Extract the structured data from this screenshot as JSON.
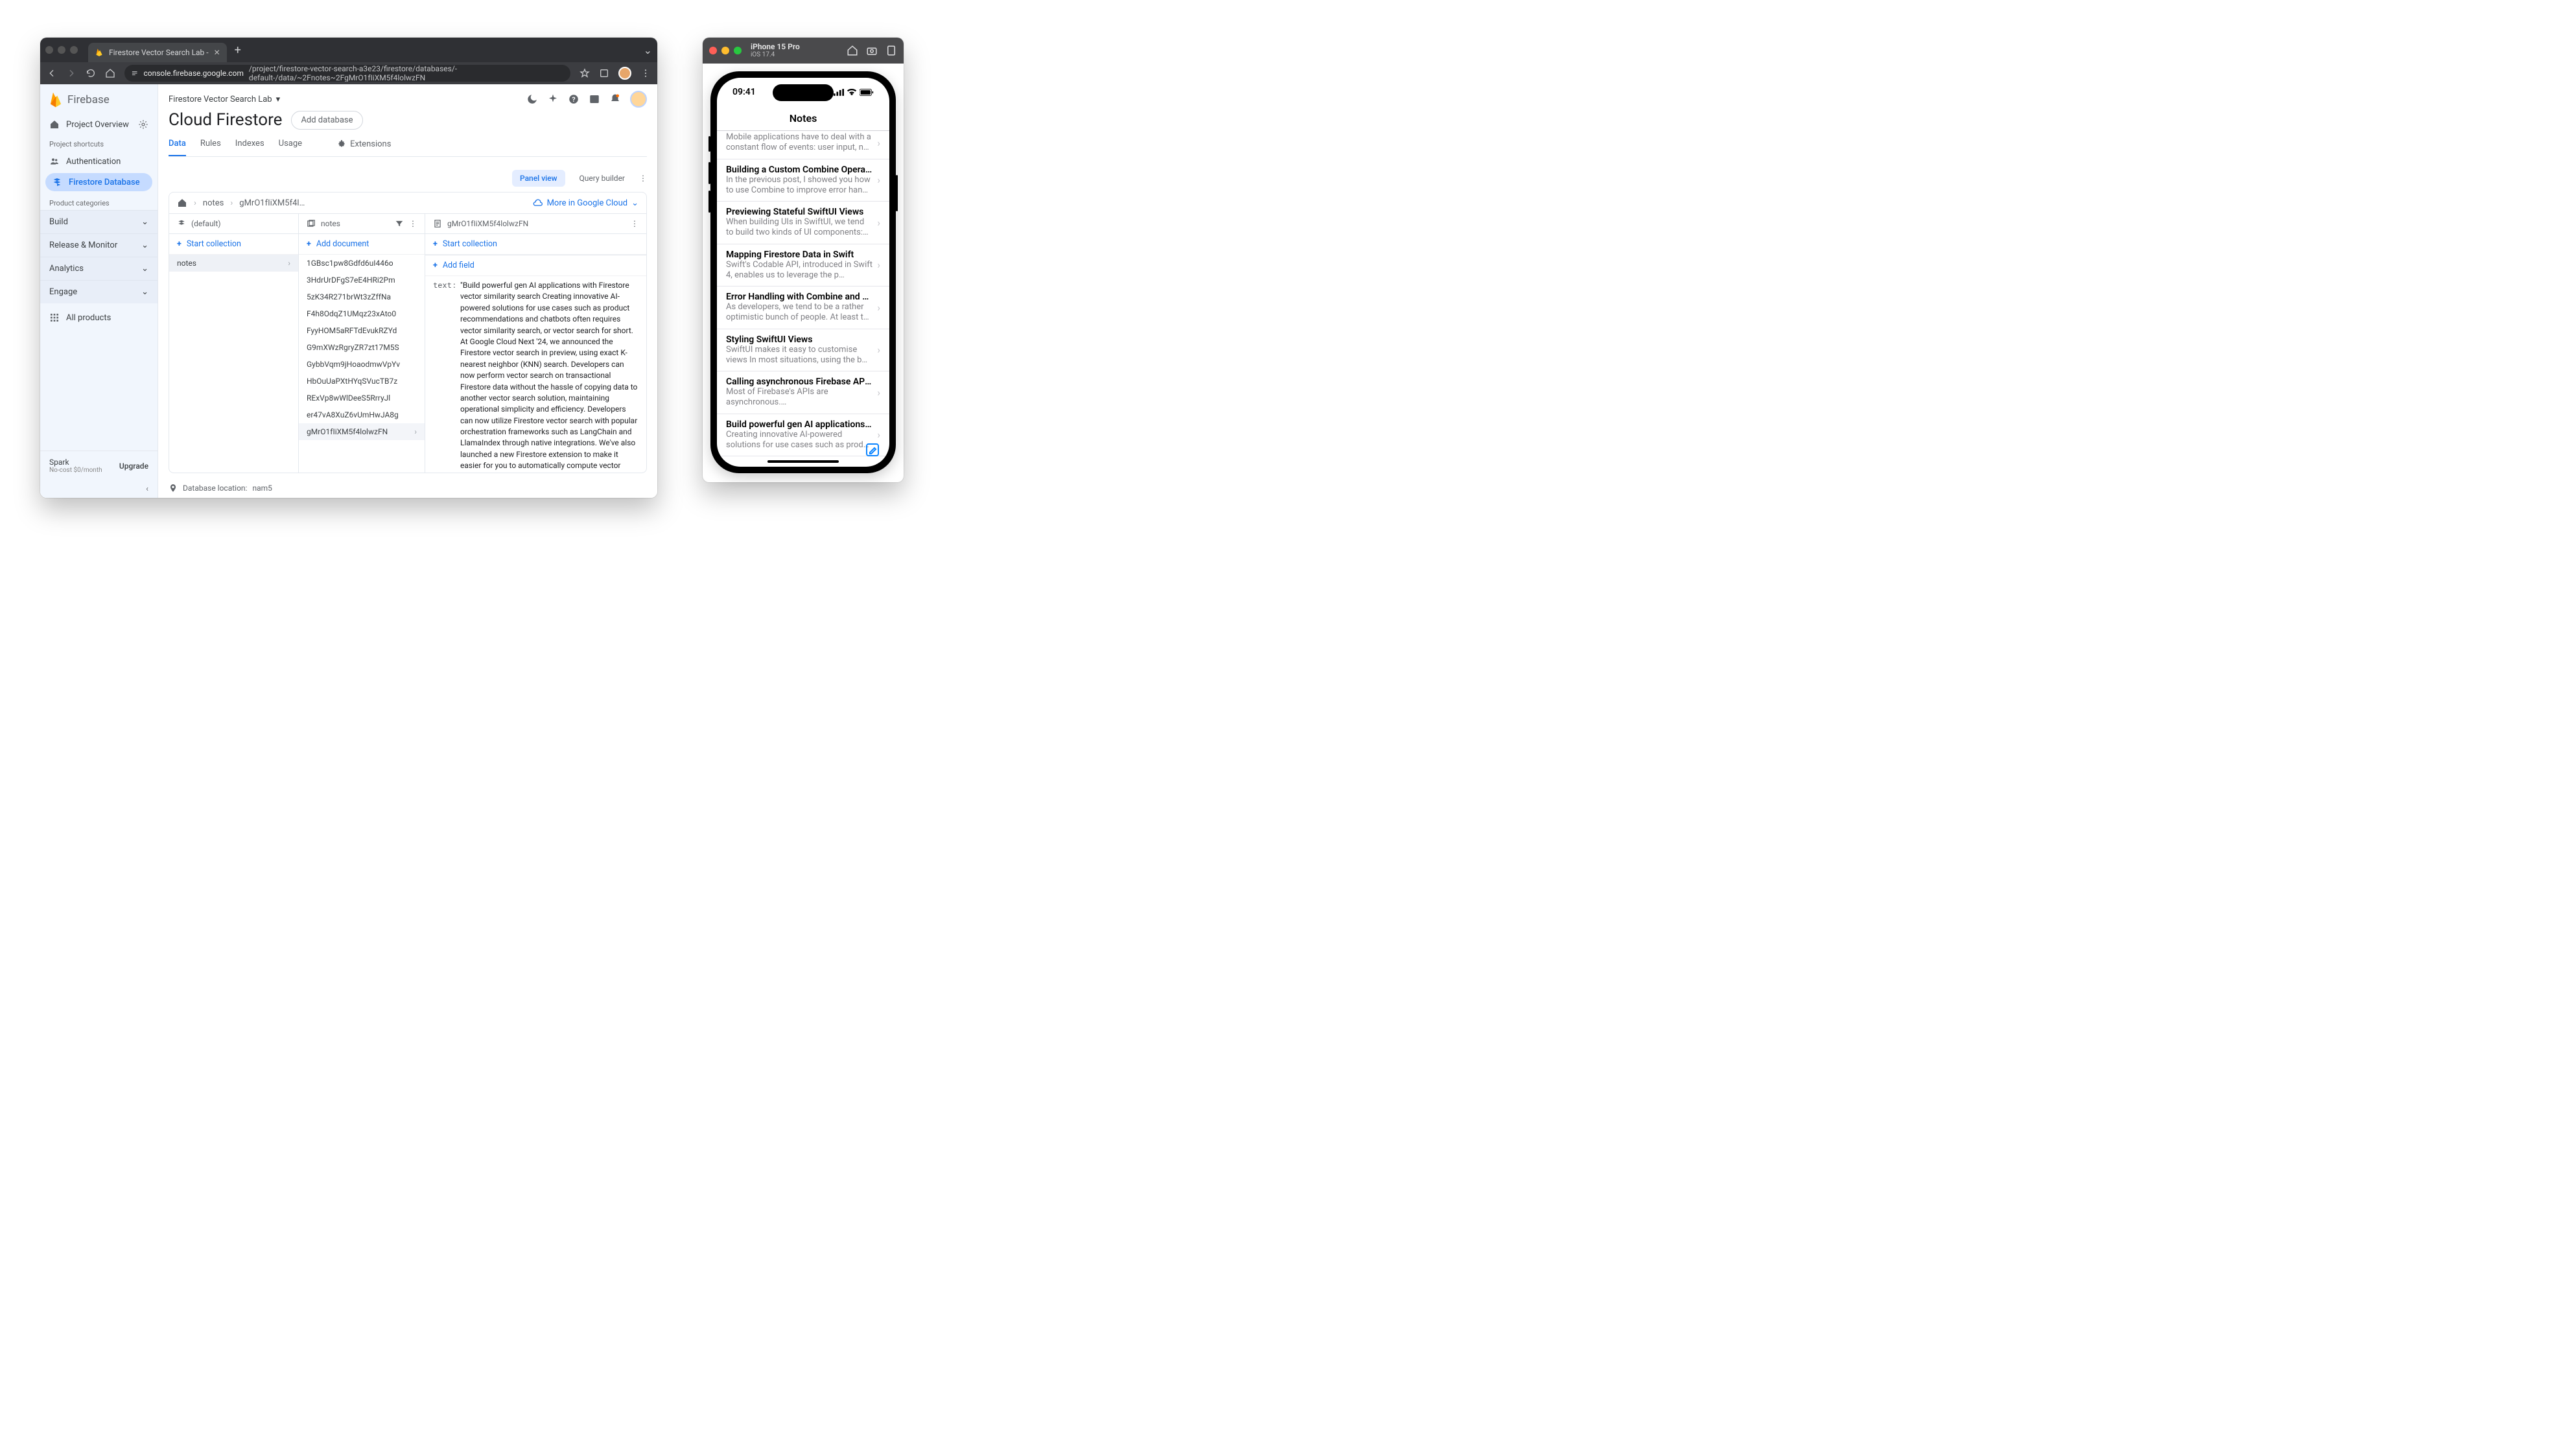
{
  "browser": {
    "tab_title": "Firestore Vector Search Lab - ",
    "url_host": "console.firebase.google.com",
    "url_path": "/project/firestore-vector-search-a3e23/firestore/databases/-default-/data/~2Fnotes~2FgMrO1fIiXM5f4lolwzFN"
  },
  "sidebar": {
    "brand": "Firebase",
    "overview": "Project Overview",
    "shortcuts_label": "Project shortcuts",
    "shortcut_auth": "Authentication",
    "shortcut_db": "Firestore Database",
    "categories_label": "Product categories",
    "cat_build": "Build",
    "cat_release": "Release & Monitor",
    "cat_analytics": "Analytics",
    "cat_engage": "Engage",
    "all_products": "All products",
    "plan_name": "Spark",
    "plan_sub": "No-cost $0/month",
    "upgrade": "Upgrade"
  },
  "header": {
    "project": "Firestore Vector Search Lab",
    "title": "Cloud Firestore",
    "add_db": "Add database",
    "tabs": {
      "data": "Data",
      "rules": "Rules",
      "indexes": "Indexes",
      "usage": "Usage",
      "extensions": "Extensions"
    }
  },
  "toolbar": {
    "panel_view": "Panel view",
    "query_builder": "Query builder"
  },
  "crumb": {
    "col": "notes",
    "doc": "gMrO1fIiXM5f4l…",
    "more": "More in Google Cloud"
  },
  "cols": {
    "root_label": "(default)",
    "notes_label": "notes",
    "doc_label": "gMrO1fIiXM5f4lolwzFN",
    "start_collection": "Start collection",
    "add_document": "Add document",
    "add_field": "Add field",
    "root_items": [
      "notes"
    ],
    "doc_ids": [
      "1GBsc1pw8Gdfd6uI446o",
      "3HdrUrDFgS7eE4HRi2Pm",
      "5zK34R271brWt3zZffNa",
      "F4h8OdqZ1UMqz23xAto0",
      "FyyHOM5aRFTdEvukRZYd",
      "G9mXWzRgryZR7zt17M5S",
      "GybbVqm9jHoaodmwVpYv",
      "HbOuUaPXtHYqSVucTB7z",
      "RExVp8wWlDeeS5RrryJl",
      "er47vA8XuZ6vUmHwJA8g",
      "gMrO1fIiXM5f4lolwzFN"
    ],
    "field_key": "text:",
    "field_val": "\"Build powerful gen AI applications with Firestore vector similarity search Creating innovative AI-powered solutions for use cases such as product recommendations and chatbots often requires vector similarity search, or vector search for short. At Google Cloud Next '24, we announced the Firestore vector search in preview, using exact K-nearest neighbor (KNN) search. Developers can now perform vector search on transactional Firestore data without the hassle of copying data to another vector search solution, maintaining operational simplicity and efficiency. Developers can now utilize Firestore vector search with popular orchestration frameworks such as LangChain and LlamaIndex through native integrations. We've also launched a new Firestore extension to make it easier for you to automatically compute vector embeddings on your data, and create web services that make it easier for you to perform vector searches from a web or mobile application. In this blog, we'll discuss how developers can get started with Firestore's new vector search"
  },
  "footer": {
    "db_loc_label": "Database location:",
    "db_loc_val": "nam5"
  },
  "sim": {
    "title": "iPhone 15 Pro",
    "subtitle": "iOS 17.4",
    "time": "09:41",
    "nav_title": "Notes",
    "notes": [
      {
        "title": "",
        "sub": "Mobile applications have to deal with a constant flow of events: user input, n…"
      },
      {
        "title": "Building a Custom Combine Operat…",
        "sub": "In the previous post, I showed you how to use Combine to improve error han…"
      },
      {
        "title": "Previewing Stateful SwiftUI Views",
        "sub": "When building UIs in SwiftUI, we tend to build two kinds of UI components:…"
      },
      {
        "title": "Mapping Firestore Data in Swift",
        "sub": "Swift's Codable API, introduced in Swift 4, enables us to leverage the p…"
      },
      {
        "title": "Error Handling with Combine and S…",
        "sub": "As developers, we tend to be a rather optimistic bunch of people. At least t…"
      },
      {
        "title": "Styling SwiftUI Views",
        "sub": "SwiftUI makes it easy to customise views In most situations, using the b…"
      },
      {
        "title": "Calling asynchronous Firebase API…",
        "sub": "Most of Firebase's APIs are asynchronous.…"
      },
      {
        "title": "Build powerful gen AI applications…",
        "sub": "Creating innovative AI-powered solutions for use cases such as prod…"
      }
    ]
  }
}
